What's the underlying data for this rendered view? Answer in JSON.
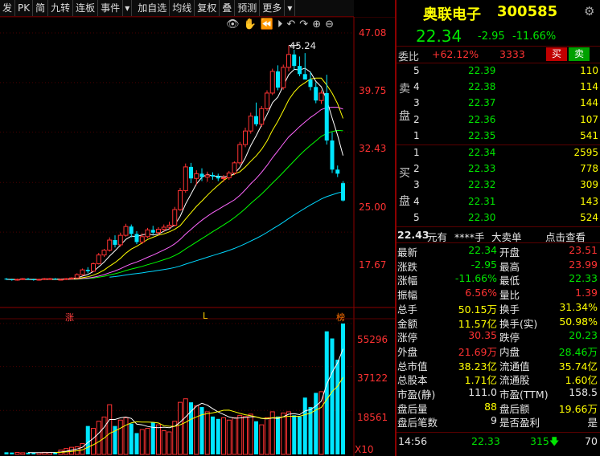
{
  "toolbar": {
    "items": [
      "发",
      "PK",
      "简",
      "九转",
      "连板",
      "事件",
      "加自选",
      "均线",
      "复权",
      "叠",
      "预测",
      "更多"
    ]
  },
  "chart": {
    "price_labels": [
      "47.08",
      "39.75",
      "32.43",
      "25.00",
      "17.67"
    ],
    "vol_labels": [
      "55296",
      "37122",
      "18561"
    ],
    "vol_unit": "X10",
    "peak_label": "45.24",
    "markers": [
      "涨",
      "L",
      "榜"
    ]
  },
  "chart_data": {
    "type": "candlestick",
    "price_axis": {
      "ylim": [
        10.34,
        47.08
      ],
      "ticks": [
        47.08,
        39.75,
        32.43,
        25.0,
        17.67
      ]
    },
    "volume_axis": {
      "ylim": [
        0,
        55296
      ],
      "ticks": [
        55296,
        37122,
        18561
      ],
      "unit": "X10"
    },
    "peak_price": 45.24,
    "candles": [
      [
        10.8,
        10.9,
        10.6,
        10.7
      ],
      [
        10.7,
        10.8,
        10.5,
        10.6
      ],
      [
        10.6,
        10.8,
        10.5,
        10.7
      ],
      [
        10.7,
        10.9,
        10.6,
        10.8
      ],
      [
        10.8,
        10.9,
        10.6,
        10.7
      ],
      [
        10.7,
        10.8,
        10.5,
        10.6
      ],
      [
        10.6,
        10.8,
        10.5,
        10.7
      ],
      [
        10.7,
        10.9,
        10.6,
        10.8
      ],
      [
        10.8,
        10.9,
        10.7,
        10.8
      ],
      [
        10.8,
        10.9,
        10.6,
        10.7
      ],
      [
        10.7,
        10.8,
        10.6,
        10.7
      ],
      [
        10.7,
        10.9,
        10.6,
        10.8
      ],
      [
        10.8,
        11.0,
        10.7,
        10.9
      ],
      [
        10.9,
        11.6,
        10.8,
        11.4
      ],
      [
        11.4,
        12.3,
        11.2,
        12.1
      ],
      [
        12.1,
        12.5,
        11.6,
        11.9
      ],
      [
        11.9,
        13.2,
        11.8,
        13.0
      ],
      [
        13.0,
        14.6,
        12.9,
        14.3
      ],
      [
        14.3,
        15.2,
        14.0,
        15.0
      ],
      [
        15.0,
        16.9,
        14.8,
        16.5
      ],
      [
        16.5,
        17.2,
        15.4,
        15.8
      ],
      [
        15.8,
        17.6,
        15.5,
        17.2
      ],
      [
        17.2,
        18.9,
        17.0,
        18.5
      ],
      [
        18.5,
        18.8,
        16.9,
        17.4
      ],
      [
        17.4,
        17.8,
        15.9,
        16.2
      ],
      [
        16.2,
        17.5,
        15.9,
        17.0
      ],
      [
        17.0,
        18.3,
        16.8,
        18.0
      ],
      [
        18.0,
        18.6,
        17.3,
        17.6
      ],
      [
        17.6,
        18.4,
        17.2,
        18.1
      ],
      [
        18.1,
        18.8,
        17.8,
        18.4
      ],
      [
        18.4,
        19.2,
        18.0,
        18.7
      ],
      [
        18.7,
        21.4,
        18.5,
        21.0
      ],
      [
        21.0,
        24.2,
        20.8,
        23.8
      ],
      [
        23.8,
        27.8,
        23.5,
        27.3
      ],
      [
        27.3,
        27.9,
        24.9,
        25.6
      ],
      [
        25.6,
        26.8,
        24.6,
        26.3
      ],
      [
        26.3,
        27.1,
        25.2,
        25.8
      ],
      [
        25.8,
        26.6,
        25.1,
        26.1
      ],
      [
        26.1,
        26.5,
        25.4,
        25.9
      ],
      [
        25.9,
        26.3,
        25.2,
        25.6
      ],
      [
        25.6,
        26.1,
        25.1,
        25.7
      ],
      [
        25.7,
        26.7,
        25.4,
        26.4
      ],
      [
        26.4,
        28.1,
        26.1,
        27.9
      ],
      [
        27.9,
        31.0,
        27.6,
        30.6
      ],
      [
        30.6,
        33.1,
        30.2,
        32.6
      ],
      [
        32.6,
        35.3,
        32.2,
        34.8
      ],
      [
        34.8,
        36.8,
        33.3,
        33.6
      ],
      [
        33.6,
        36.3,
        33.2,
        35.9
      ],
      [
        35.9,
        38.6,
        35.6,
        38.2
      ],
      [
        38.2,
        41.8,
        37.9,
        41.4
      ],
      [
        41.4,
        42.3,
        38.6,
        39.0
      ],
      [
        39.0,
        42.4,
        38.7,
        42.0
      ],
      [
        42.0,
        45.24,
        41.4,
        43.9
      ],
      [
        43.9,
        44.6,
        41.6,
        42.2
      ],
      [
        42.2,
        43.6,
        40.7,
        41.0
      ],
      [
        41.0,
        44.1,
        40.6,
        40.2
      ],
      [
        40.2,
        41.3,
        38.6,
        39.1
      ],
      [
        39.1,
        39.8,
        36.7,
        37.1
      ],
      [
        37.1,
        38.6,
        36.6,
        38.2
      ],
      [
        38.2,
        40.9,
        30.6,
        31.2
      ],
      [
        31.2,
        32.4,
        26.4,
        26.9
      ],
      [
        26.9,
        27.5,
        25.8,
        26.3
      ],
      [
        24.9,
        25.2,
        22.2,
        22.34
      ]
    ],
    "volumes": [
      900,
      800,
      850,
      700,
      750,
      800,
      700,
      900,
      850,
      800,
      1800,
      2500,
      3000,
      3200,
      4600,
      12000,
      11000,
      14000,
      15800,
      21000,
      12000,
      14500,
      15500,
      13000,
      9000,
      10500,
      11000,
      13500,
      12500,
      10000,
      9500,
      14000,
      22000,
      23500,
      22000,
      20500,
      20000,
      18000,
      16000,
      15000,
      15500,
      14500,
      15500,
      16500,
      16000,
      17000,
      14000,
      12500,
      15500,
      18000,
      16000,
      17500,
      18000,
      16500,
      16000,
      24000,
      20000,
      26000,
      26500,
      52000,
      49000,
      40000,
      55296
    ]
  },
  "stock": {
    "name": "奥联电子",
    "code": "300585"
  },
  "price": {
    "last": "22.34",
    "change": "-2.95",
    "pct": "-11.66%"
  },
  "weibi": {
    "label": "委比",
    "pct": "+62.12%",
    "diff": "3333",
    "buy": "买",
    "sell": "卖"
  },
  "sell_side": {
    "chars": [
      "卖",
      "盘"
    ],
    "rows": [
      {
        "lvl": "5",
        "price": "22.39",
        "vol": "110"
      },
      {
        "lvl": "4",
        "price": "22.38",
        "vol": "114"
      },
      {
        "lvl": "3",
        "price": "22.37",
        "vol": "144"
      },
      {
        "lvl": "2",
        "price": "22.36",
        "vol": "107"
      },
      {
        "lvl": "1",
        "price": "22.35",
        "vol": "541"
      }
    ]
  },
  "buy_side": {
    "chars": [
      "买",
      "盘"
    ],
    "rows": [
      {
        "lvl": "1",
        "price": "22.34",
        "vol": "2595"
      },
      {
        "lvl": "2",
        "price": "22.33",
        "vol": "778"
      },
      {
        "lvl": "3",
        "price": "22.32",
        "vol": "309"
      },
      {
        "lvl": "4",
        "price": "22.31",
        "vol": "143"
      },
      {
        "lvl": "5",
        "price": "22.30",
        "vol": "524"
      }
    ]
  },
  "info_bar": {
    "amt": "22.43",
    "yuan": "元有",
    "stars": "****手",
    "bigorder": "大卖单",
    "click": "点击查看"
  },
  "quote": {
    "rows": [
      {
        "l1": "最新",
        "v1": "22.34",
        "l2": "开盘",
        "v2": "23.51"
      },
      {
        "l1": "涨跌",
        "v1": "-2.95",
        "l2": "最高",
        "v2": "23.99"
      },
      {
        "l1": "涨幅",
        "v1": "-11.66%",
        "l2": "最低",
        "v2": "22.33"
      },
      {
        "l1": "振幅",
        "v1": "6.56%",
        "l2": "量比",
        "v2": "1.39"
      },
      {
        "l1": "总手",
        "v1": "50.15万",
        "l2": "换手",
        "v2": "31.34%"
      },
      {
        "l1": "金额",
        "v1": "11.57亿",
        "l2": "换手(实)",
        "v2": "50.98%"
      },
      {
        "l1": "涨停",
        "v1": "30.35",
        "l2": "跌停",
        "v2": "20.23"
      },
      {
        "l1": "外盘",
        "v1": "21.69万",
        "l2": "内盘",
        "v2": "28.46万"
      },
      {
        "l1": "总市值",
        "v1": "38.23亿",
        "l2": "流通值",
        "v2": "35.74亿"
      },
      {
        "l1": "总股本",
        "v1": "1.71亿",
        "l2": "流通股",
        "v2": "1.60亿"
      },
      {
        "l1": "市盈(静)",
        "v1": "111.0",
        "l2": "市盈(TTM)",
        "v2": "158.5"
      },
      {
        "l1": "盘后量",
        "v1": "88",
        "l2": "盘后额",
        "v2": "19.66万"
      },
      {
        "l1": "盘后笔数",
        "v1": "9",
        "l2": "是否盈利",
        "v2": "是"
      }
    ]
  },
  "tick": {
    "time": "14:56",
    "price": "22.33",
    "vol": "315",
    "num": "70"
  }
}
